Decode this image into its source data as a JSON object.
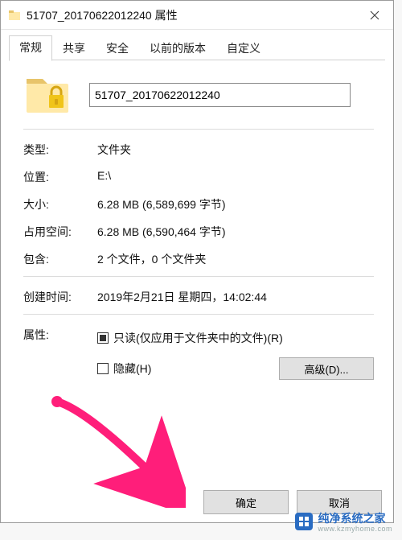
{
  "window": {
    "title": "51707_20170622012240 属性"
  },
  "tabs": {
    "items": [
      {
        "label": "常规"
      },
      {
        "label": "共享"
      },
      {
        "label": "安全"
      },
      {
        "label": "以前的版本"
      },
      {
        "label": "自定义"
      }
    ],
    "activeIndex": 0
  },
  "general": {
    "nameValue": "51707_20170622012240",
    "rows": {
      "typeLabel": "类型:",
      "typeValue": "文件夹",
      "locationLabel": "位置:",
      "locationValue": "E:\\",
      "sizeLabel": "大小:",
      "sizeValue": "6.28 MB (6,589,699 字节)",
      "diskLabel": "占用空间:",
      "diskValue": "6.28 MB (6,590,464 字节)",
      "containsLabel": "包含:",
      "containsValue": "2 个文件，0 个文件夹",
      "createdLabel": "创建时间:",
      "createdValue": "2019年2月21日 星期四，14:02:44",
      "attrLabel": "属性:"
    },
    "readonlyLabel": "只读(仅应用于文件夹中的文件)(R)",
    "hiddenLabel": "隐藏(H)",
    "advancedLabel": "高级(D)..."
  },
  "footer": {
    "ok": "确定",
    "cancel": "取消"
  },
  "watermark": {
    "text": "纯净系统之家",
    "sub": "www.kzmyhome.com"
  }
}
